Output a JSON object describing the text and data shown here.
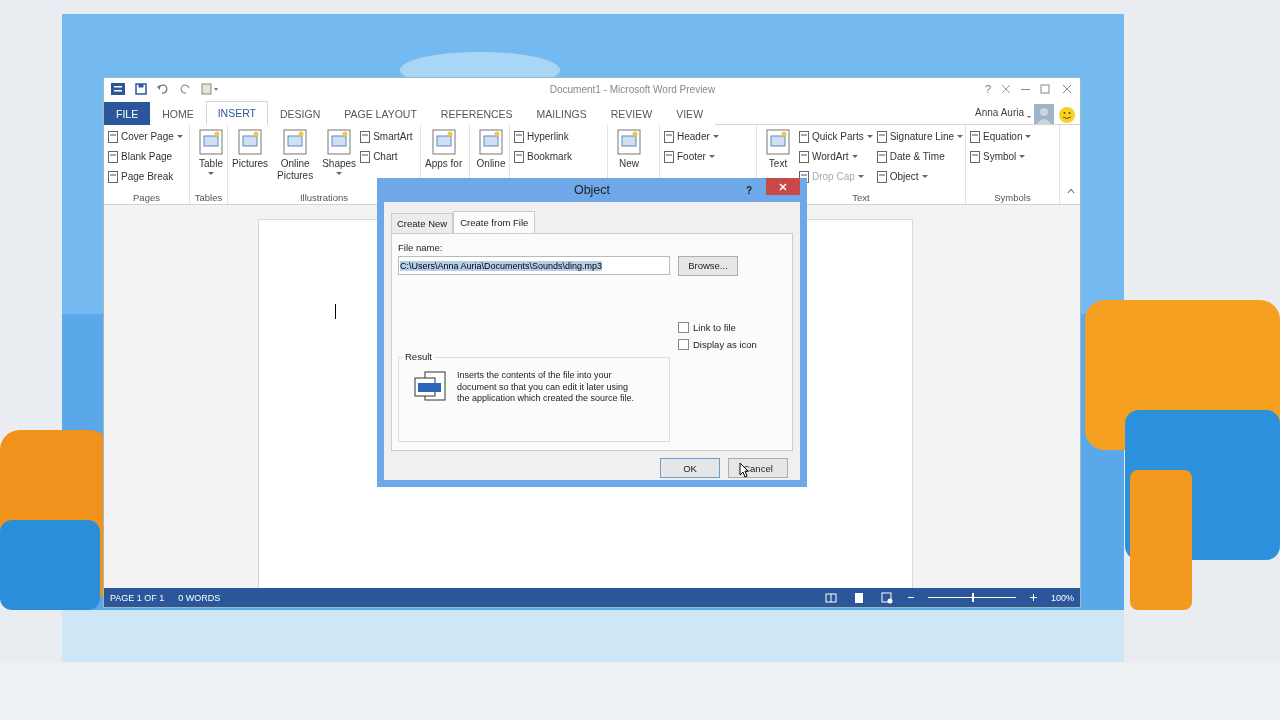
{
  "window": {
    "title": "Document1 - Microsoft Word Preview",
    "user": "Anna Auria",
    "help": "?"
  },
  "tabs": [
    {
      "label": "FILE",
      "kind": "file",
      "selected": false
    },
    {
      "label": "HOME",
      "kind": "tab",
      "selected": false
    },
    {
      "label": "INSERT",
      "kind": "tab",
      "selected": true
    },
    {
      "label": "DESIGN",
      "kind": "tab",
      "selected": false
    },
    {
      "label": "PAGE LAYOUT",
      "kind": "tab",
      "selected": false
    },
    {
      "label": "REFERENCES",
      "kind": "tab",
      "selected": false
    },
    {
      "label": "MAILINGS",
      "kind": "tab",
      "selected": false
    },
    {
      "label": "REVIEW",
      "kind": "tab",
      "selected": false
    },
    {
      "label": "VIEW",
      "kind": "tab",
      "selected": false
    }
  ],
  "ribbon": [
    {
      "label": "Pages",
      "columns": [
        {
          "kind": "stack",
          "items": [
            {
              "label": "Cover Page",
              "dropdown": true,
              "disabled": false
            },
            {
              "label": "Blank Page",
              "dropdown": false,
              "disabled": false
            },
            {
              "label": "Page Break",
              "dropdown": false,
              "disabled": false
            }
          ]
        }
      ]
    },
    {
      "label": "Tables",
      "columns": [
        {
          "kind": "large",
          "label": "Table",
          "dropdown": true
        }
      ]
    },
    {
      "label": "Illustrations",
      "columns": [
        {
          "kind": "large",
          "label": "Pictures",
          "dropdown": false
        },
        {
          "kind": "large",
          "label": "Online Pictures",
          "dropdown": false
        },
        {
          "kind": "large",
          "label": "Shapes",
          "dropdown": true
        },
        {
          "kind": "stack",
          "items": [
            {
              "label": "SmartArt",
              "dropdown": false,
              "disabled": false
            },
            {
              "label": "Chart",
              "dropdown": false,
              "disabled": false
            }
          ]
        }
      ]
    },
    {
      "columns": [
        {
          "kind": "large",
          "label": "Apps for",
          "dropdown": false
        }
      ]
    },
    {
      "columns": [
        {
          "kind": "large",
          "label": "Online",
          "dropdown": false
        }
      ]
    },
    {
      "columns": [
        {
          "kind": "stack",
          "items": [
            {
              "label": "Hyperlink",
              "dropdown": false,
              "disabled": false
            },
            {
              "label": "Bookmark",
              "dropdown": false,
              "disabled": false
            }
          ]
        }
      ]
    },
    {
      "columns": [
        {
          "kind": "large",
          "label": "New",
          "dropdown": false
        }
      ]
    },
    {
      "columns": [
        {
          "kind": "stack",
          "items": [
            {
              "label": "Header",
              "dropdown": true,
              "disabled": false
            },
            {
              "label": "Footer",
              "dropdown": true,
              "disabled": false
            }
          ]
        }
      ]
    },
    {
      "label": "Text",
      "columns": [
        {
          "kind": "large",
          "label": "Text",
          "dropdown": false
        },
        {
          "kind": "stack",
          "items": [
            {
              "label": "Quick Parts",
              "dropdown": true,
              "disabled": false
            },
            {
              "label": "WordArt",
              "dropdown": true,
              "disabled": false
            },
            {
              "label": "Drop Cap",
              "dropdown": true,
              "disabled": true
            }
          ]
        },
        {
          "kind": "stack",
          "items": [
            {
              "label": "Signature Line",
              "dropdown": true,
              "disabled": false
            },
            {
              "label": "Date & Time",
              "dropdown": false,
              "disabled": false
            },
            {
              "label": "Object",
              "dropdown": true,
              "disabled": false
            }
          ]
        }
      ]
    },
    {
      "label": "Symbols",
      "columns": [
        {
          "kind": "stack",
          "items": [
            {
              "label": "Equation",
              "dropdown": true,
              "disabled": false
            },
            {
              "label": "Symbol",
              "dropdown": true,
              "disabled": false
            }
          ]
        }
      ]
    }
  ],
  "status_bar": {
    "page": "PAGE 1 OF 1",
    "words": "0 WORDS",
    "zoom": {
      "level": 0.5,
      "reading": "100%"
    }
  },
  "dialog": {
    "title": "Object",
    "help": "?",
    "tabs": [
      {
        "label": "Create New",
        "selected": false
      },
      {
        "label": "Create from File",
        "selected": true
      }
    ],
    "file_name": {
      "label": "File name:",
      "value": "C:\\Users\\Anna Auria\\Documents\\Sounds\\ding.mp3",
      "highlighted": true
    },
    "browse": "Browse...",
    "options": [
      {
        "label": "Link to file",
        "checked": false
      },
      {
        "label": "Display as icon",
        "checked": false
      }
    ],
    "result": {
      "label": "Result",
      "text": "Inserts the contents of the file into your document so that you can edit it later using the application which created the source file."
    },
    "buttons": [
      {
        "label": "OK",
        "default": true
      },
      {
        "label": "Cancel",
        "default": false
      }
    ]
  }
}
